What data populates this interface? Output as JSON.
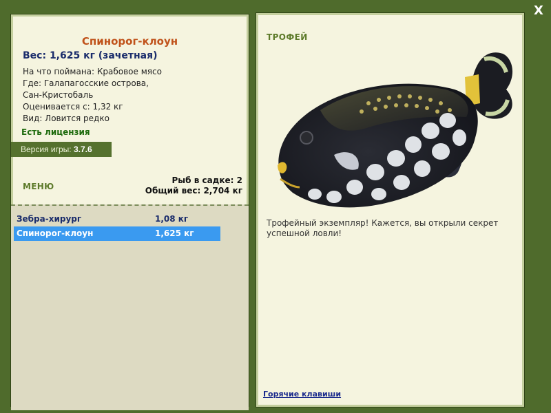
{
  "window": {
    "close_label": "X"
  },
  "fish": {
    "title": "Спинорог-клоун",
    "weight_line": "Вес: 1,625 кг (зачетная)",
    "caught_on": "На что поймана: Крабовое мясо",
    "where_line1": "Где: Галапагосские острова,",
    "where_line2": "Сан-Кристобаль",
    "valued_from": "Оценивается с: 1,32 кг",
    "kind": "Вид: Ловится редко",
    "license": "Есть лицензия"
  },
  "version": {
    "label": "Версия игры: ",
    "value": "3.7.6"
  },
  "menu": {
    "label": "МЕНЮ"
  },
  "keep": {
    "count_line": "Рыб в садке: 2",
    "total_line": "Общий вес: 2,704 кг"
  },
  "catch_list": [
    {
      "name": "Зебра-хирург",
      "weight": "1,08 кг",
      "selected": false
    },
    {
      "name": "Спинорог-клоун",
      "weight": "1,625 кг",
      "selected": true
    }
  ],
  "trophy": {
    "label": "ТРОФЕЙ",
    "text": "Трофейный экземпляр! Кажется, вы открыли секрет успешной ловли!"
  },
  "hotkeys": {
    "label": "Горячие клавиши"
  },
  "colors": {
    "background": "#4f6b2c",
    "panel": "#f5f4df",
    "title": "#c0521a",
    "selected_row": "#3a9af0",
    "menu_label": "#5d7a2a"
  }
}
